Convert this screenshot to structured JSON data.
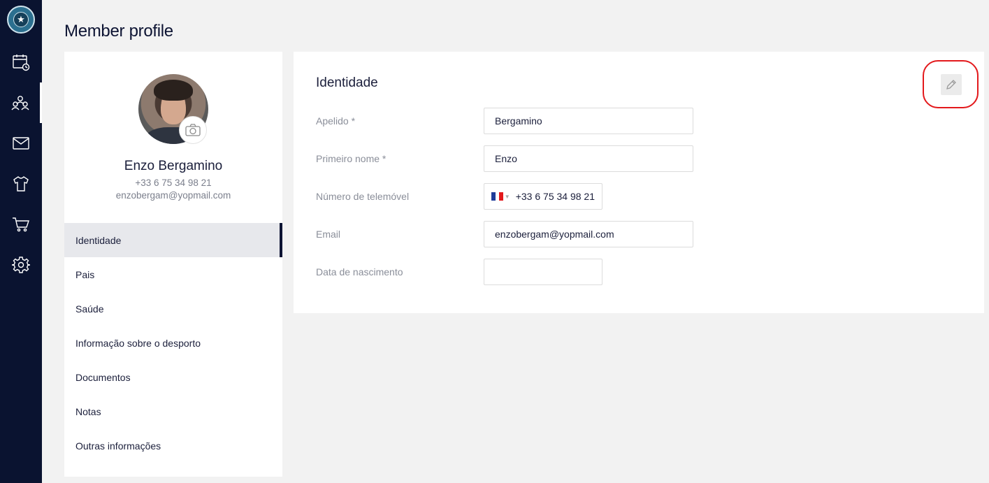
{
  "page_title": "Member profile",
  "colors": {
    "sidebar_bg": "#0a1330",
    "highlight": "#e3191c",
    "active_menu_bg": "#e7e8ec"
  },
  "sidebar": {
    "items": [
      {
        "name": "calendar",
        "icon": "calendar-clock-icon",
        "active": false
      },
      {
        "name": "members",
        "icon": "users-icon",
        "active": true
      },
      {
        "name": "messages",
        "icon": "mail-icon",
        "active": false
      },
      {
        "name": "equipment",
        "icon": "tshirt-icon",
        "active": false
      },
      {
        "name": "shop",
        "icon": "cart-icon",
        "active": false
      },
      {
        "name": "settings",
        "icon": "gear-icon",
        "active": false
      }
    ]
  },
  "profile": {
    "name": "Enzo Bergamino",
    "phone": "+33 6 75 34 98 21",
    "email": "enzobergam@yopmail.com"
  },
  "menu": {
    "items": [
      {
        "label": "Identidade",
        "active": true
      },
      {
        "label": "Pais",
        "active": false
      },
      {
        "label": "Saúde",
        "active": false
      },
      {
        "label": "Informação sobre o desporto",
        "active": false
      },
      {
        "label": "Documentos",
        "active": false
      },
      {
        "label": "Notas",
        "active": false
      },
      {
        "label": "Outras informações",
        "active": false
      }
    ]
  },
  "identity": {
    "title": "Identidade",
    "fields": {
      "last_name": {
        "label": "Apelido *",
        "value": "Bergamino"
      },
      "first_name": {
        "label": "Primeiro nome *",
        "value": "Enzo"
      },
      "mobile": {
        "label": "Número de telemóvel",
        "value": "+33 6 75 34 98 21",
        "country_flag": "france-flag-icon"
      },
      "email": {
        "label": "Email",
        "value": "enzobergam@yopmail.com"
      },
      "birth_date": {
        "label": "Data de nascimento",
        "value": ""
      }
    }
  }
}
